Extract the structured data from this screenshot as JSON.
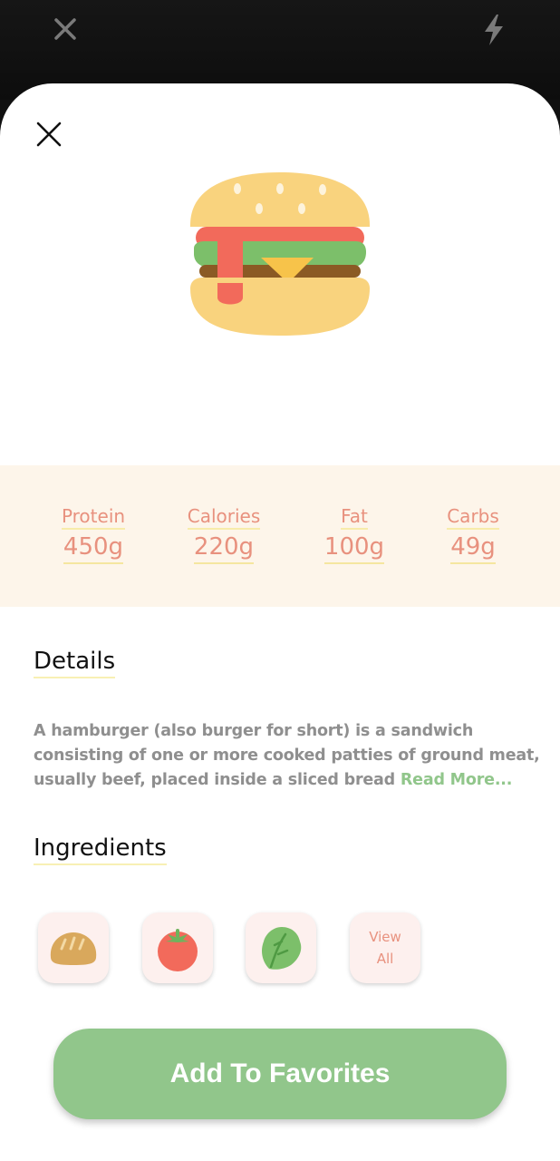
{
  "top_bar": {
    "close_icon": "close-icon",
    "flash_icon": "flash-icon"
  },
  "sheet": {
    "close_icon": "close-icon",
    "food_icon": "hamburger-icon"
  },
  "nutrition": [
    {
      "label": "Protein",
      "value": "450g"
    },
    {
      "label": "Calories",
      "value": "220g"
    },
    {
      "label": "Fat",
      "value": "100g"
    },
    {
      "label": "Carbs",
      "value": "49g"
    }
  ],
  "details": {
    "title": "Details",
    "description": "A hamburger (also burger for short) is a sandwich consisting of one or more cooked patties of ground meat, usually beef, placed inside a sliced bread",
    "read_more": "Read More..."
  },
  "ingredients": {
    "title": "Ingredients",
    "items": [
      {
        "icon": "bread-icon"
      },
      {
        "icon": "tomato-icon"
      },
      {
        "icon": "lettuce-icon"
      }
    ],
    "view_all_line1": "View",
    "view_all_line2": "All"
  },
  "actions": {
    "add_to_favorites": "Add To Favorites"
  },
  "colors": {
    "accent_green": "#91c68b",
    "nutrient_text": "#e8917e",
    "nutrition_bg": "#fdf5ea"
  }
}
